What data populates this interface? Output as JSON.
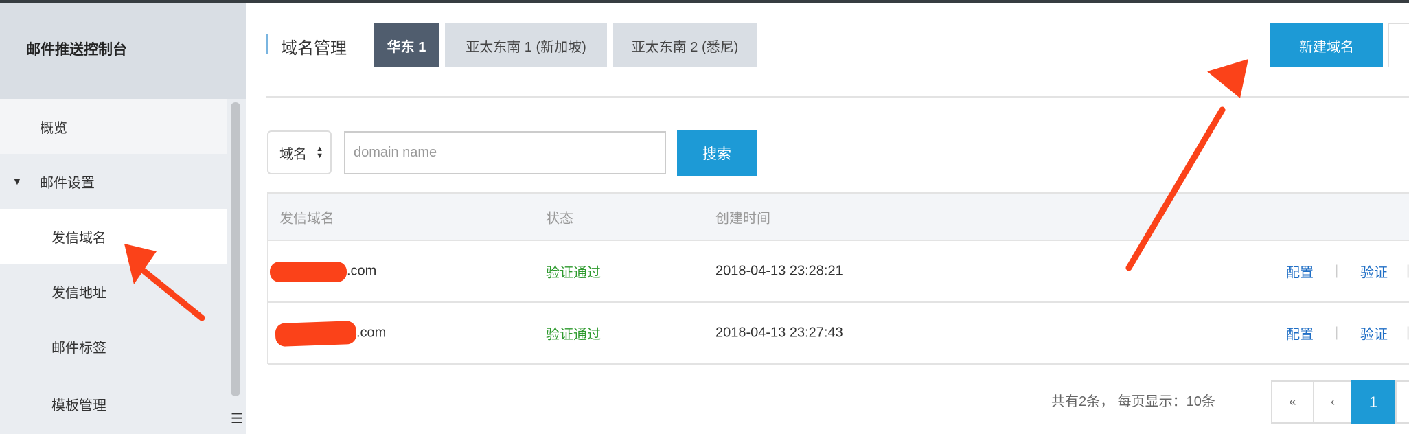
{
  "sidebar": {
    "title": "邮件推送控制台",
    "items": [
      {
        "label": "概览"
      },
      {
        "label": "邮件设置",
        "expanded": true
      },
      {
        "label": "发信域名",
        "active": true
      },
      {
        "label": "发信地址"
      },
      {
        "label": "邮件标签"
      },
      {
        "label": "模板管理"
      }
    ]
  },
  "header": {
    "title": "域名管理",
    "tabs": [
      {
        "label": "华东 1",
        "active": true
      },
      {
        "label": "亚太东南 1 (新加坡)"
      },
      {
        "label": "亚太东南 2 (悉尼)"
      }
    ],
    "new_button": "新建域名"
  },
  "search": {
    "select_value": "域名",
    "placeholder": "domain name",
    "button": "搜索"
  },
  "table": {
    "columns": [
      "发信域名",
      "状态",
      "创建时间"
    ],
    "rows": [
      {
        "domain": ".com",
        "status": "验证通过",
        "created": "2018-04-13 23:28:21",
        "actions": [
          "配置",
          "验证"
        ]
      },
      {
        "domain": ".com",
        "status": "验证通过",
        "created": "2018-04-13 23:27:43",
        "actions": [
          "配置",
          "验证"
        ]
      }
    ],
    "separator": "|"
  },
  "pagination": {
    "summary": "共有2条， 每页显示：10条",
    "first": "«",
    "prev": "‹",
    "current": "1"
  },
  "colors": {
    "accent": "#1d9ad6",
    "annotation": "#fb4219",
    "success": "#2e9a2e"
  }
}
